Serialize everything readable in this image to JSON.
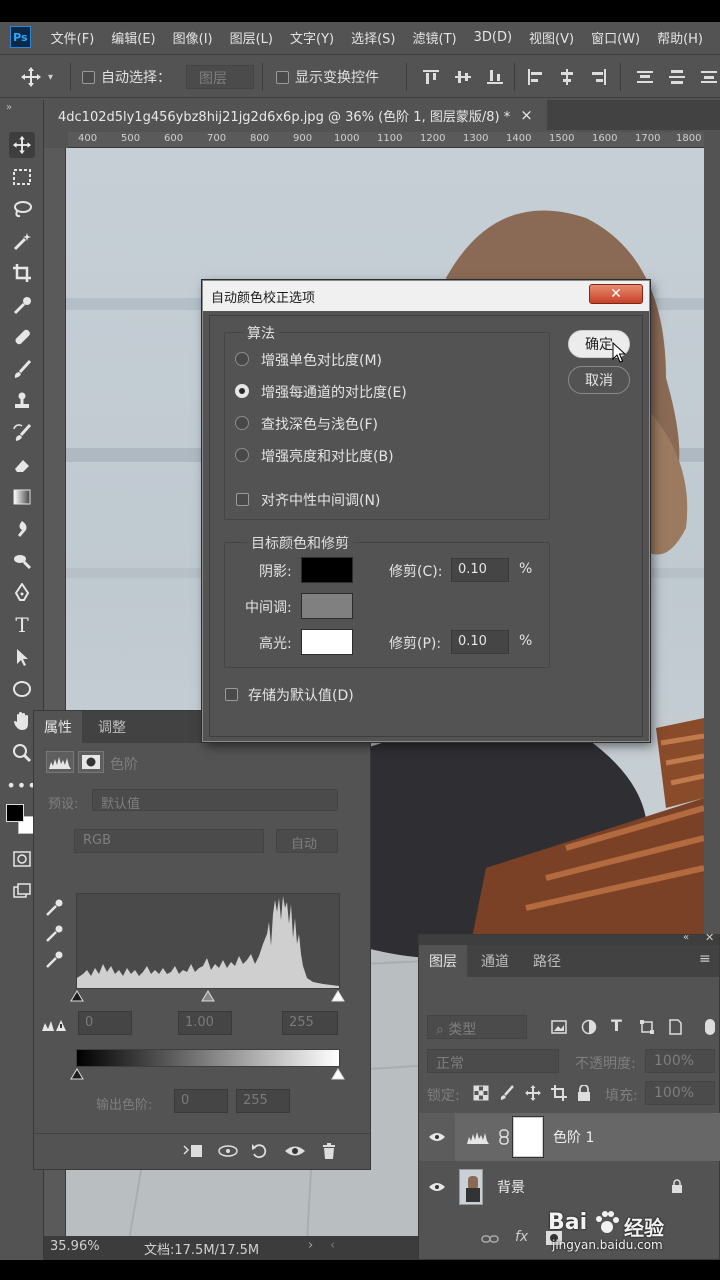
{
  "menubar": {
    "logo": "Ps",
    "items": [
      "文件(F)",
      "编辑(E)",
      "图像(I)",
      "图层(L)",
      "文字(Y)",
      "选择(S)",
      "滤镜(T)",
      "3D(D)",
      "视图(V)",
      "窗口(W)",
      "帮助(H)"
    ]
  },
  "options": {
    "auto_select_label": "自动选择：",
    "auto_select_value": "图层",
    "show_transform_label": "显示变换控件"
  },
  "document": {
    "tab_title": "4dc102d5ly1g456ybz8hij21jg2d6x6p.jpg @ 36% (色阶 1, 图层蒙版/8) *",
    "close": "×"
  },
  "ruler": {
    "ticks": [
      "400",
      "500",
      "600",
      "700",
      "800",
      "900",
      "1000",
      "1100",
      "1200",
      "1300",
      "1400",
      "1500",
      "1600",
      "1700",
      "1800"
    ]
  },
  "status": {
    "zoom": "35.96%",
    "doc_size": "文档:17.5M/17.5M"
  },
  "dialog": {
    "title": "自动颜色校正选项",
    "close": "✕",
    "algorithm_title": "算法",
    "algorithms": [
      "增强单色对比度(M)",
      "增强每通道的对比度(E)",
      "查找深色与浅色(F)",
      "增强亮度和对比度(B)"
    ],
    "selected_algorithm": 1,
    "snap_neutral": "对齐中性中间调(N)",
    "target_title": "目标颜色和修剪",
    "shadows_label": "阴影:",
    "midtones_label": "中间调:",
    "highlights_label": "高光:",
    "clip_label_c": "修剪(C):",
    "clip_label_p": "修剪(P):",
    "clip_c_value": "0.10",
    "clip_p_value": "0.10",
    "percent": "%",
    "save_default": "存储为默认值(D)",
    "ok": "确定",
    "cancel": "取消",
    "colors": {
      "shadow": "#000000",
      "midtone": "#808080",
      "highlight": "#ffffff"
    }
  },
  "properties": {
    "tabs": [
      "属性",
      "调整"
    ],
    "title": "色阶",
    "preset_label": "预设:",
    "preset_value": "默认值",
    "channel": "RGB",
    "auto": "自动",
    "input_black": "0",
    "input_gamma": "1.00",
    "input_white": "255",
    "output_label": "输出色阶:",
    "output_black": "0",
    "output_white": "255"
  },
  "layers": {
    "tabs": [
      "图层",
      "通道",
      "路径"
    ],
    "filter_label": "类型",
    "blend_mode": "正常",
    "opacity_label": "不透明度:",
    "opacity_value": "100%",
    "lock_label": "锁定:",
    "fill_label": "填充:",
    "fill_value": "100%",
    "items": [
      {
        "name": "色阶 1"
      },
      {
        "name": "背景"
      }
    ]
  },
  "watermark": {
    "brand": "Bai",
    "sub": "经验",
    "url": "jingyan.baidu.com"
  }
}
